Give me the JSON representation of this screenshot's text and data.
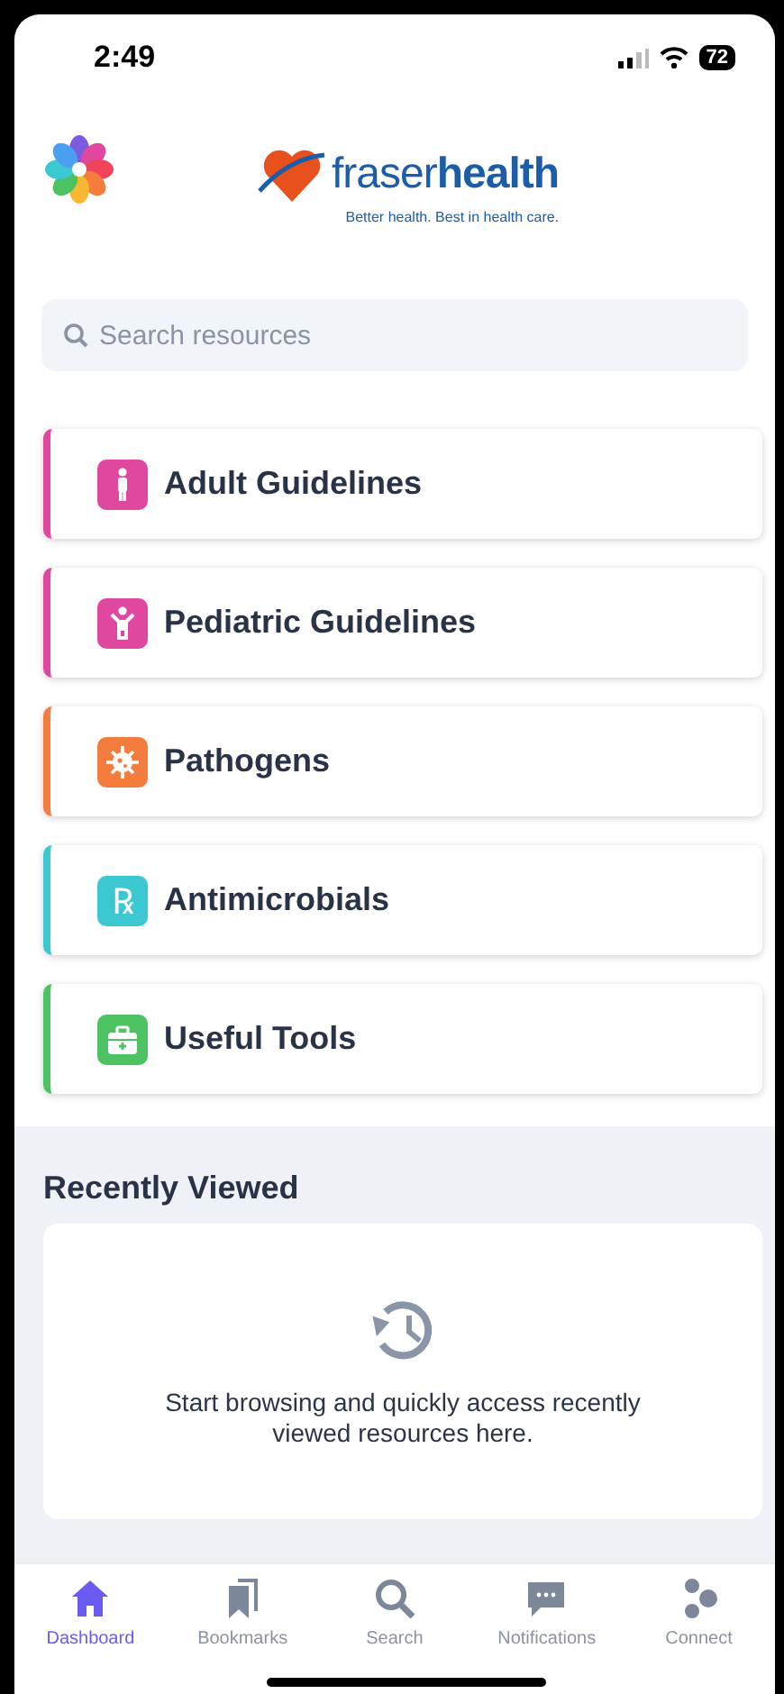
{
  "status_bar": {
    "time": "2:49",
    "battery": "72"
  },
  "header": {
    "brand": "fraser**health**",
    "tagline": "Better health. Best in health care."
  },
  "search": {
    "placeholder": "Search resources"
  },
  "categories": [
    {
      "label": "Adult Guidelines",
      "kind": "adult",
      "color": "#e0489f"
    },
    {
      "label": "Pediatric Guidelines",
      "kind": "child",
      "color": "#e0489f"
    },
    {
      "label": "Pathogens",
      "kind": "virus",
      "color": "#f47c3c"
    },
    {
      "label": "Antimicrobials",
      "kind": "rx",
      "color": "#3cc8d0",
      "glyph": "℞"
    },
    {
      "label": "Useful Tools",
      "kind": "kit",
      "color": "#4cc262"
    }
  ],
  "recent": {
    "title": "Recently Viewed",
    "empty_message": "Start browsing and quickly access recently viewed resources here."
  },
  "tabs": [
    {
      "label": "Dashboard",
      "kind": "home",
      "selected": true
    },
    {
      "label": "Bookmarks",
      "kind": "bookmarks",
      "selected": false
    },
    {
      "label": "Search",
      "kind": "search",
      "selected": false
    },
    {
      "label": "Notifications",
      "kind": "chat",
      "selected": false
    },
    {
      "label": "Connect",
      "kind": "connect",
      "selected": false
    }
  ]
}
